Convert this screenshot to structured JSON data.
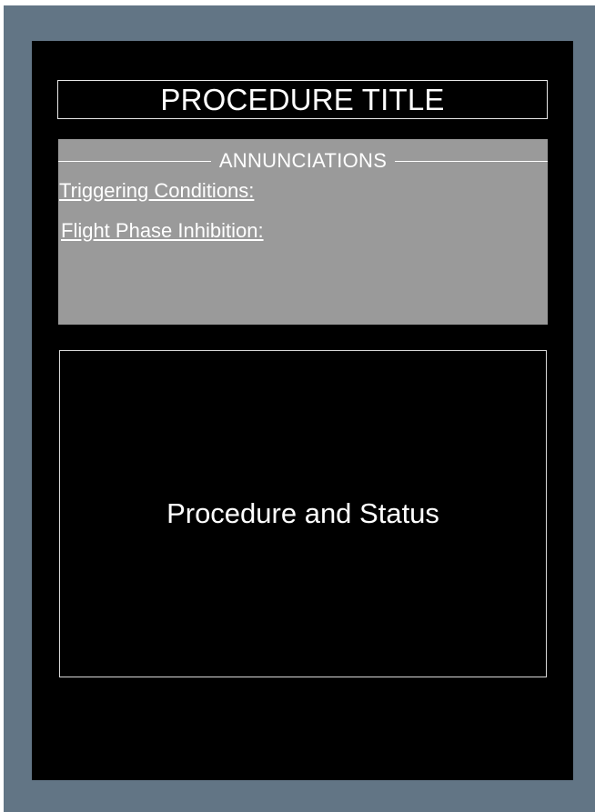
{
  "title": "PROCEDURE TITLE",
  "annunciations": {
    "header": "ANNUNCIATIONS",
    "triggering_conditions": "Triggering Conditions:",
    "flight_phase_inhibition": "Flight Phase Inhibition:"
  },
  "status_panel": {
    "label": "Procedure and Status"
  },
  "colors": {
    "bezel": "#627585",
    "display_background": "#000000",
    "annunciation_panel": "#9a9a9a",
    "text": "#ffffff"
  }
}
